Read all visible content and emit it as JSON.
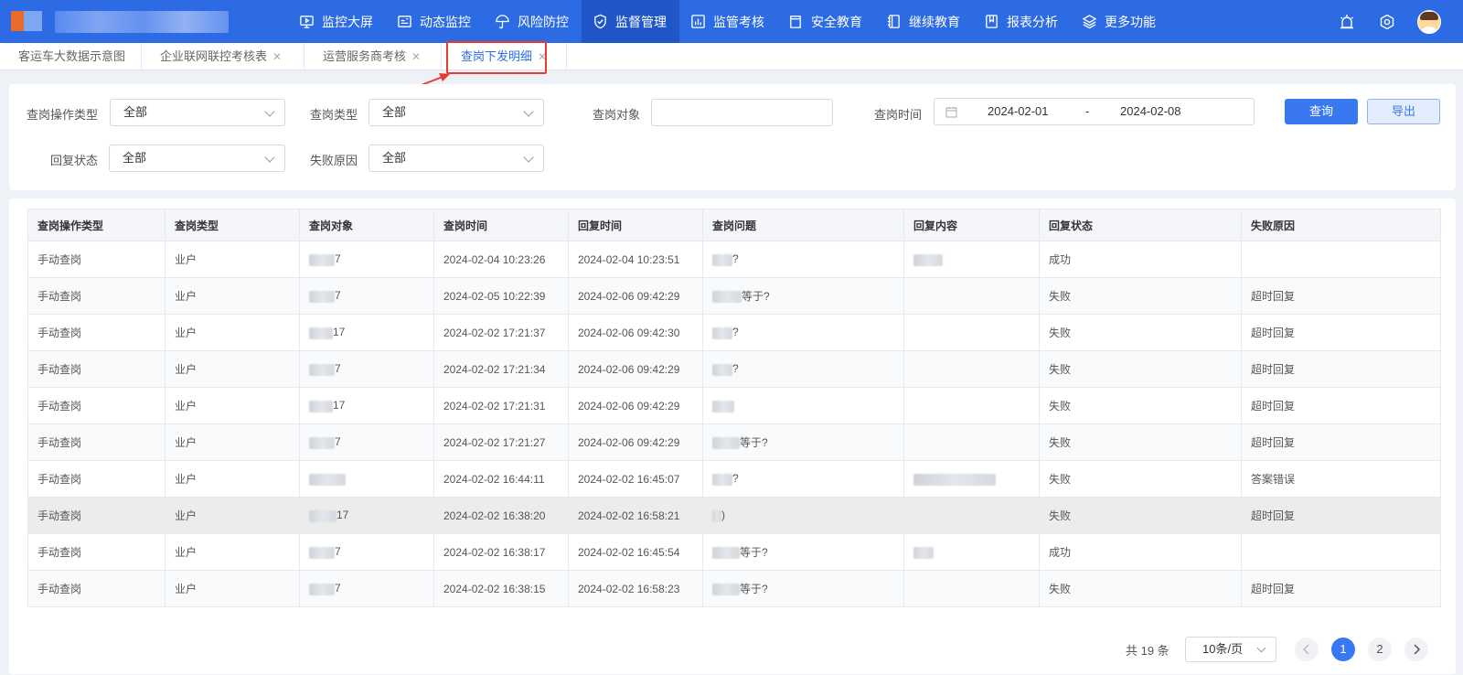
{
  "nav": {
    "items": [
      {
        "label": "监控大屏",
        "icon": "monitor-icon"
      },
      {
        "label": "动态监控",
        "icon": "id-card-icon"
      },
      {
        "label": "风险防控",
        "icon": "umbrella-icon"
      },
      {
        "label": "监督管理",
        "icon": "shield-check-icon",
        "active": true
      },
      {
        "label": "监管考核",
        "icon": "bar-chart-icon"
      },
      {
        "label": "安全教育",
        "icon": "book-icon"
      },
      {
        "label": "继续教育",
        "icon": "notebook-icon"
      },
      {
        "label": "报表分析",
        "icon": "bookmark-icon"
      },
      {
        "label": "更多功能",
        "icon": "layers-icon"
      }
    ],
    "right_icons": [
      "alarm-light-icon",
      "settings-hexagon-icon",
      "user-avatar-icon"
    ]
  },
  "tabs": [
    {
      "label": "客运车大数据示意图",
      "closable": false
    },
    {
      "label": "企业联网联控考核表",
      "closable": true
    },
    {
      "label": "运营服务商考核",
      "closable": true
    },
    {
      "label": "查岗下发明细",
      "closable": true,
      "active": true
    }
  ],
  "filters": {
    "op_type_label": "查岗操作类型",
    "op_type_value": "全部",
    "check_type_label": "查岗类型",
    "check_type_value": "全部",
    "target_label": "查岗对象",
    "target_value": "",
    "time_label": "查岗时间",
    "time_start": "2024-02-01",
    "time_sep": "-",
    "time_end": "2024-02-08",
    "reply_status_label": "回复状态",
    "reply_status_value": "全部",
    "fail_reason_label": "失败原因",
    "fail_reason_value": "全部",
    "query_button": "查询",
    "export_button": "导出"
  },
  "table": {
    "columns": [
      "查岗操作类型",
      "查岗类型",
      "查岗对象",
      "查岗时间",
      "回复时间",
      "查岗问题",
      "回复内容",
      "回复状态",
      "失败原因"
    ],
    "rows": [
      {
        "op": "手动查岗",
        "type": "业户",
        "target": "7",
        "check_time": "2024-02-04 10:23:26",
        "reply_time": "2024-02-04 10:23:51",
        "question": "?",
        "answer": "",
        "status": "成功",
        "reason": ""
      },
      {
        "op": "手动查岗",
        "type": "业户",
        "target": "7",
        "check_time": "2024-02-05 10:22:39",
        "reply_time": "2024-02-06 09:42:29",
        "question": "等于?",
        "answer": "",
        "status": "失败",
        "reason": "超时回复"
      },
      {
        "op": "手动查岗",
        "type": "业户",
        "target": "17",
        "check_time": "2024-02-02 17:21:37",
        "reply_time": "2024-02-06 09:42:30",
        "question": "?",
        "answer": "",
        "status": "失败",
        "reason": "超时回复"
      },
      {
        "op": "手动查岗",
        "type": "业户",
        "target": "7",
        "check_time": "2024-02-02 17:21:34",
        "reply_time": "2024-02-06 09:42:29",
        "question": "?",
        "answer": "",
        "status": "失败",
        "reason": "超时回复"
      },
      {
        "op": "手动查岗",
        "type": "业户",
        "target": "17",
        "check_time": "2024-02-02 17:21:31",
        "reply_time": "2024-02-06 09:42:29",
        "question": "",
        "answer": "",
        "status": "失败",
        "reason": "超时回复"
      },
      {
        "op": "手动查岗",
        "type": "业户",
        "target": "7",
        "check_time": "2024-02-02 17:21:27",
        "reply_time": "2024-02-06 09:42:29",
        "question": "等于?",
        "answer": "",
        "status": "失败",
        "reason": "超时回复"
      },
      {
        "op": "手动查岗",
        "type": "业户",
        "target": "",
        "check_time": "2024-02-02 16:44:11",
        "reply_time": "2024-02-02 16:45:07",
        "question": "?",
        "answer": "",
        "status": "失败",
        "reason": "答案错误"
      },
      {
        "op": "手动查岗",
        "type": "业户",
        "target": "17",
        "check_time": "2024-02-02 16:38:20",
        "reply_time": "2024-02-02 16:58:21",
        "question": ")",
        "answer": "",
        "status": "失败",
        "reason": "超时回复"
      },
      {
        "op": "手动查岗",
        "type": "业户",
        "target": "7",
        "check_time": "2024-02-02 16:38:17",
        "reply_time": "2024-02-02 16:45:54",
        "question": "等于?",
        "answer": "",
        "status": "成功",
        "reason": ""
      },
      {
        "op": "手动查岗",
        "type": "业户",
        "target": "7",
        "check_time": "2024-02-02 16:38:15",
        "reply_time": "2024-02-02 16:58:23",
        "question": "等于?",
        "answer": "",
        "status": "失败",
        "reason": "超时回复"
      }
    ]
  },
  "pagination": {
    "total_text": "共 19 条",
    "page_size": "10条/页",
    "pages": [
      "1",
      "2"
    ],
    "current": "1"
  }
}
